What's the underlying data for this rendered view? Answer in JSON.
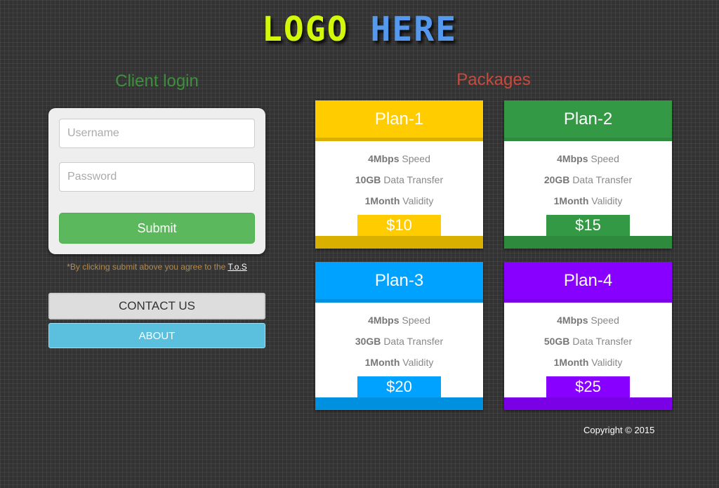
{
  "logo": {
    "part1": "LOGO",
    "part2": "HERE",
    "color1": "#d4f80a",
    "color2": "#5599ee"
  },
  "login": {
    "title": "Client login",
    "username_placeholder": "Username",
    "password_placeholder": "Password",
    "submit_label": "Submit",
    "tos_text": "*By clicking submit above you agree to the ",
    "tos_link": "T.o.S"
  },
  "nav": {
    "contact_label": "CONTACT US",
    "about_label": "ABOUT"
  },
  "packages": {
    "title": "Packages",
    "plans": [
      {
        "name": "Plan-1",
        "speed": "4Mbps",
        "data": "10GB",
        "validity": "1Month",
        "price": "$10",
        "color": "#ffcc00",
        "dark": "#d9b000"
      },
      {
        "name": "Plan-2",
        "speed": "4Mbps",
        "data": "20GB",
        "validity": "1Month",
        "price": "$15",
        "color": "#339944",
        "dark": "#2e8a3d"
      },
      {
        "name": "Plan-3",
        "speed": "4Mbps",
        "data": "30GB",
        "validity": "1Month",
        "price": "$20",
        "color": "#00a2ff",
        "dark": "#0090e0"
      },
      {
        "name": "Plan-4",
        "speed": "4Mbps",
        "data": "50GB",
        "validity": "1Month",
        "price": "$25",
        "color": "#8800ff",
        "dark": "#7a00e6"
      }
    ],
    "speed_label": "Speed",
    "data_label": "Data Transfer",
    "validity_label": "Validity"
  },
  "footer": {
    "copyright": "Copyright © 2015"
  }
}
